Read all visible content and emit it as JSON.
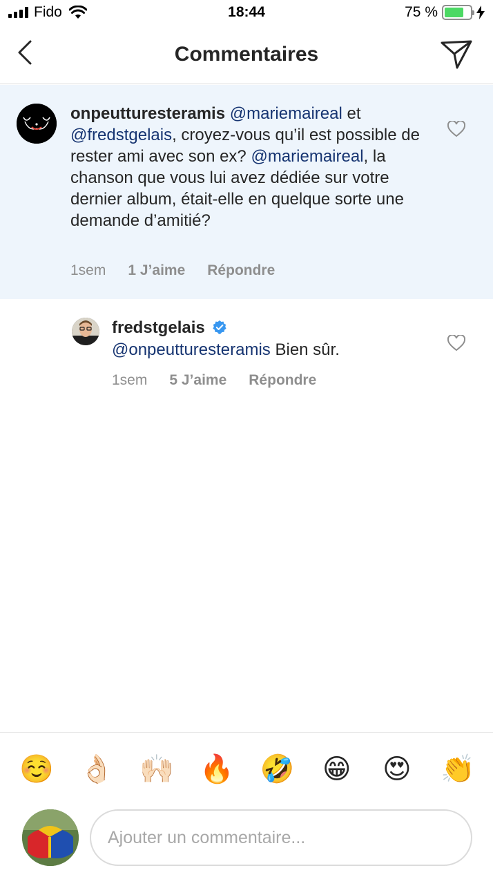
{
  "status_bar": {
    "carrier": "Fido",
    "time": "18:44",
    "battery_percent": "75 %",
    "battery_level": 0.75
  },
  "nav": {
    "title": "Commentaires",
    "back_icon": "chevron-left-icon",
    "send_icon": "paper-plane-icon"
  },
  "comments": [
    {
      "username": "onpeutturesteramis",
      "segments": [
        {
          "text": "@mariemaireal",
          "mention": true
        },
        {
          "text": " et ",
          "mention": false
        },
        {
          "text": "@fredstgelais",
          "mention": true
        },
        {
          "text": ", croyez-vous qu’il est possible de rester ami avec son ex? ",
          "mention": false
        },
        {
          "text": "@mariemaireal",
          "mention": true
        },
        {
          "text": ", la chanson que vous lui avez dédiée sur votre dernier album, était-elle en quelque sorte une demande d’amitié?",
          "mention": false
        }
      ],
      "time": "1sem",
      "likes": "1 J’aime",
      "reply": "Répondre"
    },
    {
      "username": "fredstgelais",
      "verified": true,
      "segments": [
        {
          "text": "@onpeutturesteramis",
          "mention": true
        },
        {
          "text": " Bien sûr.",
          "mention": false
        }
      ],
      "time": "1sem",
      "likes": "5 J’aime",
      "reply": "Répondre"
    }
  ],
  "emoji_bar": [
    "☺️",
    "👌🏻",
    "🙌🏻",
    "🔥",
    "🤣",
    "😁",
    "😍",
    "👏"
  ],
  "composer": {
    "placeholder": "Ajouter un commentaire..."
  },
  "colors": {
    "mention": "#163471",
    "highlight_bg": "#eef5fc",
    "verified": "#3897f0",
    "battery": "#4cd964"
  }
}
